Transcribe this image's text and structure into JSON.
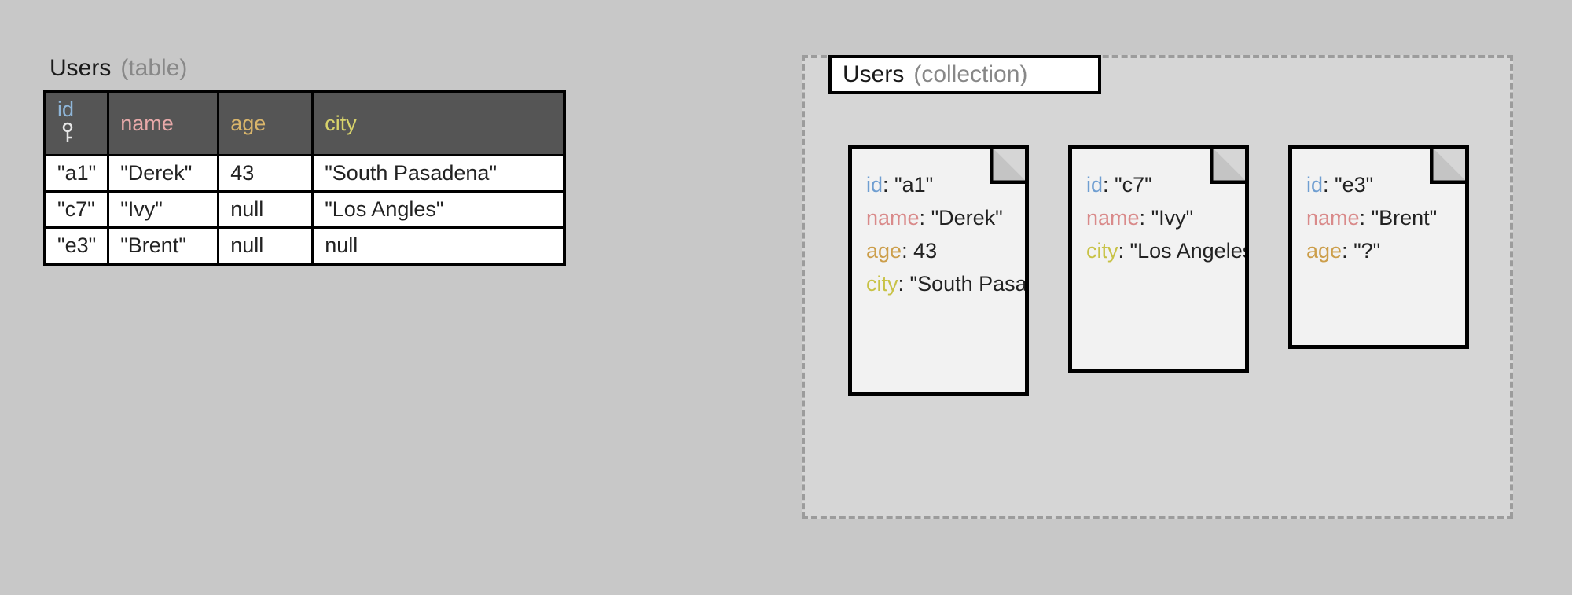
{
  "table": {
    "title": "Users",
    "subtitle": "(table)",
    "columns": {
      "id": "id",
      "name": "name",
      "age": "age",
      "city": "city"
    },
    "rows": [
      {
        "id": "\"a1\"",
        "name": "\"Derek\"",
        "age": "43",
        "city": "\"South Pasadena\""
      },
      {
        "id": "\"c7\"",
        "name": "\"Ivy\"",
        "age": "null",
        "city": "\"Los Angles\""
      },
      {
        "id": "\"e3\"",
        "name": "\"Brent\"",
        "age": "null",
        "city": " null"
      }
    ]
  },
  "collection": {
    "title": "Users",
    "subtitle": "(collection)",
    "docs": [
      {
        "lines": [
          {
            "key": "id",
            "cls": "k-id",
            "val": "\"a1\""
          },
          {
            "key": "name",
            "cls": "k-name",
            "val": "\"Derek\""
          },
          {
            "key": "age",
            "cls": "k-age",
            "val": "43"
          },
          {
            "key": "city",
            "cls": "k-city",
            "val": "\"South Pasadena\""
          }
        ]
      },
      {
        "lines": [
          {
            "key": "id",
            "cls": "k-id",
            "val": "\"c7\""
          },
          {
            "key": "name",
            "cls": "k-name",
            "val": "\"Ivy\""
          },
          {
            "key": "city",
            "cls": "k-city",
            "val": "\"Los Angeles\""
          }
        ]
      },
      {
        "lines": [
          {
            "key": "id",
            "cls": "k-id",
            "val": "\"e3\""
          },
          {
            "key": "name",
            "cls": "k-name",
            "val": "\"Brent\""
          },
          {
            "key": "age",
            "cls": "k-age",
            "val": "\"?\""
          }
        ]
      }
    ]
  }
}
